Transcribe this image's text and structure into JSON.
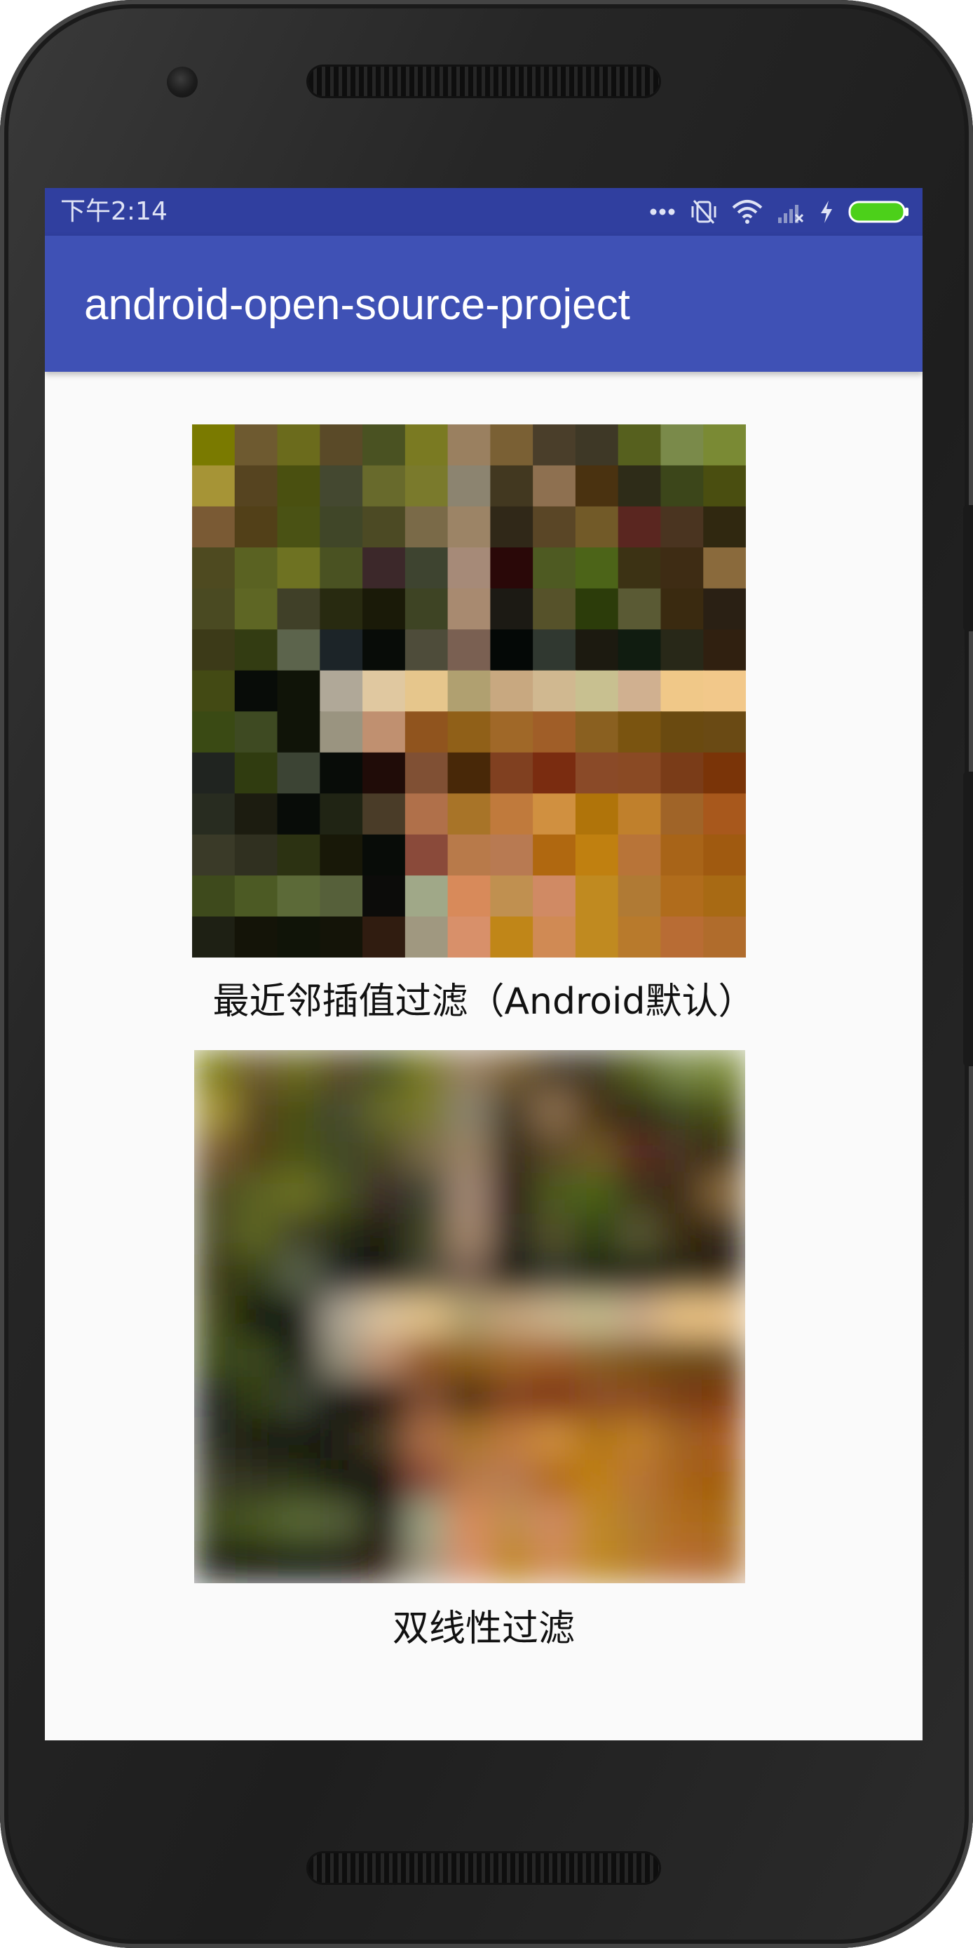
{
  "status_bar": {
    "time": "下午2:14",
    "icons": [
      "more-dots-icon",
      "vibrate-off-icon",
      "wifi-icon",
      "no-signal-icon",
      "charging-icon",
      "battery-icon"
    ],
    "color": "#303f9f"
  },
  "app_bar": {
    "title": "android-open-source-project",
    "color": "#3f51b5"
  },
  "images": [
    {
      "caption": "最近邻插值过滤（Android默认）",
      "filter": "nearest-neighbor"
    },
    {
      "caption": "双线性过滤",
      "filter": "bilinear"
    }
  ],
  "palette": [
    [
      "#7a7a00",
      "#6e5a30",
      "#6b6b1c",
      "#5a4a28",
      "#4a5222",
      "#7a7a22",
      "#9a8060",
      "#7a6034",
      "#4a3e2a",
      "#3e3826",
      "#56601e",
      "#7a8a4a",
      "#7a8a34"
    ],
    [
      "#a69436",
      "#564420",
      "#4a5010",
      "#444830",
      "#686a2c",
      "#7a7a2c",
      "#8c8470",
      "#423820",
      "#8e7050",
      "#4a3210",
      "#2e2c18",
      "#3c461a",
      "#4a4e10"
    ],
    [
      "#7a5a34",
      "#524018",
      "#4a5214",
      "#404628",
      "#4c4a24",
      "#7a6a48",
      "#9c8466",
      "#302818",
      "#5a4626",
      "#725a28",
      "#5a2620",
      "#4a3420",
      "#302810"
    ],
    [
      "#4e4a20",
      "#5a6222",
      "#6e7222",
      "#4a5222",
      "#3c282a",
      "#3e4430",
      "#a68a78",
      "#2a0808",
      "#4e5a22",
      "#4c6418",
      "#3c3214",
      "#3e2c14",
      "#8a6a3c"
    ],
    [
      "#4a4a22",
      "#5e6624",
      "#404028",
      "#282a10",
      "#1a1a08",
      "#3e4424",
      "#a88a70",
      "#1c1a14",
      "#56522a",
      "#2c3c0a",
      "#5a5a34",
      "#3a2a10",
      "#2a2014"
    ],
    [
      "#3c3a18",
      "#333c12",
      "#5c644c",
      "#1c2428",
      "#080c08",
      "#4e4c3a",
      "#7a6052",
      "#040806",
      "#303830",
      "#1c1a10",
      "#101c10",
      "#282818",
      "#302010"
    ],
    [
      "#434a14",
      "#080c08",
      "#101408",
      "#b0a898",
      "#e0c8a0",
      "#e6c68c",
      "#b0a070",
      "#c8a880",
      "#d0b890",
      "#c8c090",
      "#d0b090",
      "#f0c888",
      "#f2c88a"
    ],
    [
      "#3a4a14",
      "#3e4a22",
      "#101408",
      "#9a9480",
      "#c09070",
      "#90541e",
      "#906018",
      "#a06828",
      "#a05e28",
      "#8a6020",
      "#7a5410",
      "#6a4a10",
      "#6a4a14"
    ],
    [
      "#202420",
      "#303c10",
      "#3c4434",
      "#080c08",
      "#200c08",
      "#805034",
      "#482808",
      "#804020",
      "#7a2c10",
      "#8a4a28",
      "#8a4a24",
      "#7a3c18",
      "#7a3408"
    ],
    [
      "#282c20",
      "#1c1c10",
      "#080c08",
      "#202414",
      "#4a3c28",
      "#b0704a",
      "#a87428",
      "#c07a3c",
      "#d09040",
      "#b0740a",
      "#c0802c",
      "#a06428",
      "#a8581c"
    ],
    [
      "#3a3a28",
      "#303020",
      "#2c3212",
      "#181808",
      "#080c08",
      "#8a4a3a",
      "#b87a4a",
      "#b87a52",
      "#b06810",
      "#c08010",
      "#b87438",
      "#a86418",
      "#a05a10"
    ],
    [
      "#3e4a1c",
      "#4c5a24",
      "#5c6a38",
      "#56603a",
      "#0c0c0a",
      "#a0a888",
      "#d88a5a",
      "#c09050",
      "#d08a64",
      "#c08a20",
      "#b07a34",
      "#b06c1c",
      "#a86a14"
    ],
    [
      "#1e2014",
      "#141408",
      "#101408",
      "#141408",
      "#301c10",
      "#a09880",
      "#d8906a",
      "#c08618",
      "#d08a54",
      "#c08a20",
      "#b87a2c",
      "#b86c34",
      "#b06c2c"
    ]
  ]
}
